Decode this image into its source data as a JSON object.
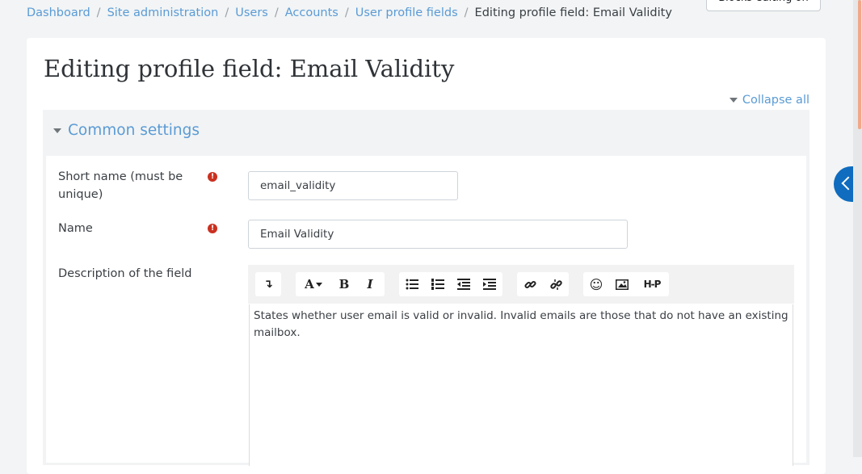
{
  "breadcrumb": {
    "items": [
      "Dashboard",
      "Site administration",
      "Users",
      "Accounts",
      "User profile fields"
    ],
    "current": "Editing profile field: Email Validity",
    "separator": "/"
  },
  "header": {
    "blocks_button": "Blocks editing on"
  },
  "page": {
    "title": "Editing profile field: Email Validity"
  },
  "collapse_all": "Collapse all",
  "section": {
    "legend": "Common settings"
  },
  "fields": {
    "shortname": {
      "label": "Short name (must be unique)",
      "value": "email_validity"
    },
    "name": {
      "label": "Name",
      "value": "Email Validity"
    },
    "description": {
      "label": "Description of the field",
      "value": "States whether user email is valid or invalid. Invalid emails are those that do not have an existing mailbox."
    }
  },
  "toolbar": {
    "buttons": [
      "show-more-icon",
      "font-color-icon",
      "bold-icon",
      "italic-icon",
      "unordered-list-icon",
      "ordered-list-icon",
      "outdent-icon",
      "indent-icon",
      "link-icon",
      "unlink-icon",
      "emoji-icon",
      "image-icon",
      "h5p-icon"
    ],
    "glyphs": {
      "bold": "B",
      "italic": "I",
      "font": "A",
      "h5p": "H-P",
      "more": "↴",
      "emoji": "☺"
    }
  },
  "colors": {
    "link": "#5a9bd5",
    "required": "#ca3120",
    "drawer": "#0f6cbf"
  }
}
